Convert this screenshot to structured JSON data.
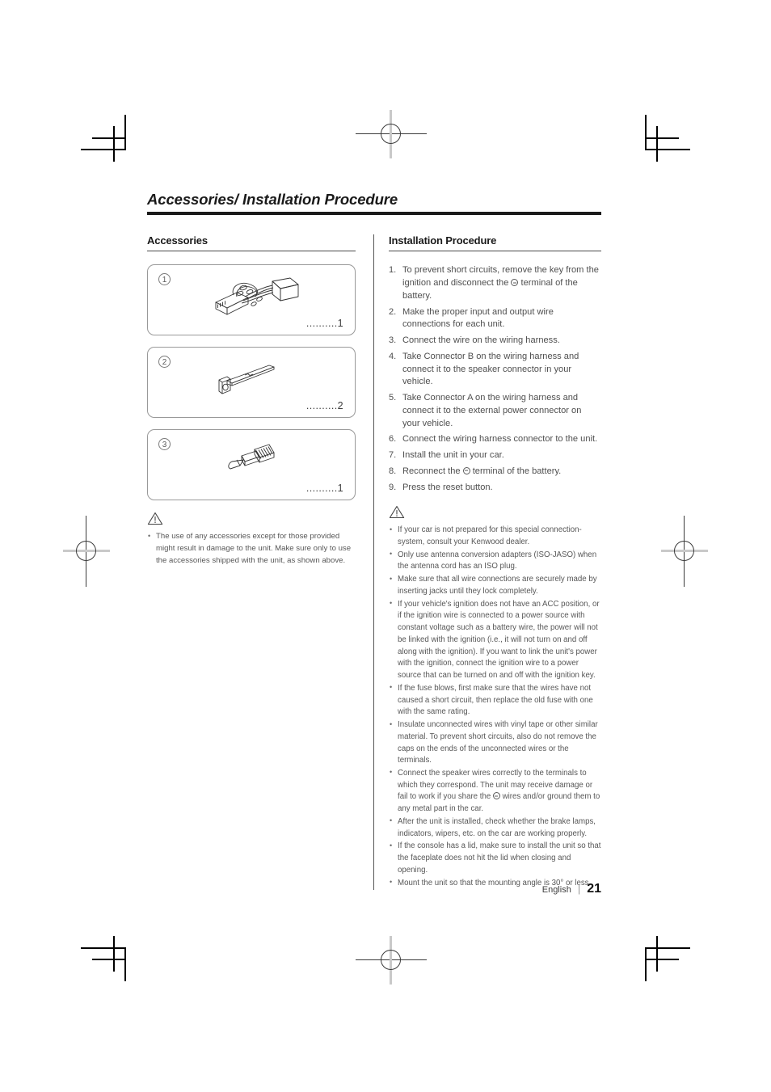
{
  "document": {
    "title": "Accessories/ Installation Procedure",
    "footer": {
      "language": "English",
      "separator": "|",
      "page_number": "21"
    }
  },
  "accessories_section": {
    "heading": "Accessories",
    "items": [
      {
        "number": "1",
        "icon": "wiring-harness-icon",
        "leader": "..........",
        "quantity": "1"
      },
      {
        "number": "2",
        "icon": "extraction-key-icon",
        "leader": "..........",
        "quantity": "2"
      },
      {
        "number": "3",
        "icon": "antenna-adapter-icon",
        "leader": "..........",
        "quantity": "1"
      }
    ],
    "caution": {
      "icon": "warning-triangle-icon",
      "bullets": [
        "The use of any accessories except for those provided might result in damage to the unit. Make sure only to use the accessories shipped with the unit, as shown above."
      ]
    }
  },
  "installation_section": {
    "heading": "Installation Procedure",
    "steps": [
      {
        "num": "1.",
        "before": "To prevent short circuits, remove the key from the ignition and disconnect the ",
        "symbol": "negative-terminal-icon",
        "after": " terminal of the battery."
      },
      {
        "num": "2.",
        "before": "Make the proper input and output wire connections for each unit.",
        "symbol": "",
        "after": ""
      },
      {
        "num": "3.",
        "before": "Connect the wire on the wiring harness.",
        "symbol": "",
        "after": ""
      },
      {
        "num": "4.",
        "before": "Take Connector B on the wiring harness and connect it to the speaker connector in your vehicle.",
        "symbol": "",
        "after": ""
      },
      {
        "num": "5.",
        "before": "Take Connector A on the wiring harness and connect it to the external power connector on your vehicle.",
        "symbol": "",
        "after": ""
      },
      {
        "num": "6.",
        "before": "Connect the wiring harness connector to the unit.",
        "symbol": "",
        "after": ""
      },
      {
        "num": "7.",
        "before": "Install the unit in your car.",
        "symbol": "",
        "after": ""
      },
      {
        "num": "8.",
        "before": "Reconnect the ",
        "symbol": "negative-terminal-icon",
        "after": " terminal of the battery."
      },
      {
        "num": "9.",
        "before": "Press the reset button.",
        "symbol": "",
        "after": ""
      }
    ],
    "caution": {
      "icon": "warning-triangle-icon",
      "bullets": [
        "If your car is not prepared for this special connection-system, consult your Kenwood dealer.",
        "Only use antenna conversion adapters (ISO-JASO) when the antenna cord has an ISO plug.",
        "Make sure that all wire connections are securely made by inserting jacks until they lock completely.",
        "If your vehicle's ignition does not have an ACC position, or if the ignition wire is connected to a power source with constant voltage such as a battery wire, the power will not be linked with the ignition (i.e., it will not turn on and off along with the ignition). If you want to link the unit's power with the ignition, connect the ignition wire to a power source that can be turned on and off with the ignition key.",
        "If the fuse blows, first make sure that the wires have not caused a short circuit, then replace the old fuse with one with the same rating.",
        "Insulate unconnected wires with vinyl tape or other similar material. To prevent short circuits, also do not remove the caps on the ends of the unconnected wires or the terminals.",
        "After the unit is installed, check whether the brake lamps, indicators, wipers, etc. on the car are working properly.",
        "If the console has a lid, make sure to install the unit so that the faceplate does not hit the lid when closing and opening.",
        "Mount the unit so that the mounting angle is 30° or less."
      ],
      "speaker_bullet": {
        "before": "Connect the speaker wires correctly to the terminals to which they correspond. The unit may receive damage or fail to work if you share the ",
        "symbol": "negative-terminal-icon",
        "after": " wires and/or ground them to any metal part in the car."
      }
    }
  },
  "print_marks": {
    "corner_crop_marks": 4,
    "registration_targets": 4
  }
}
